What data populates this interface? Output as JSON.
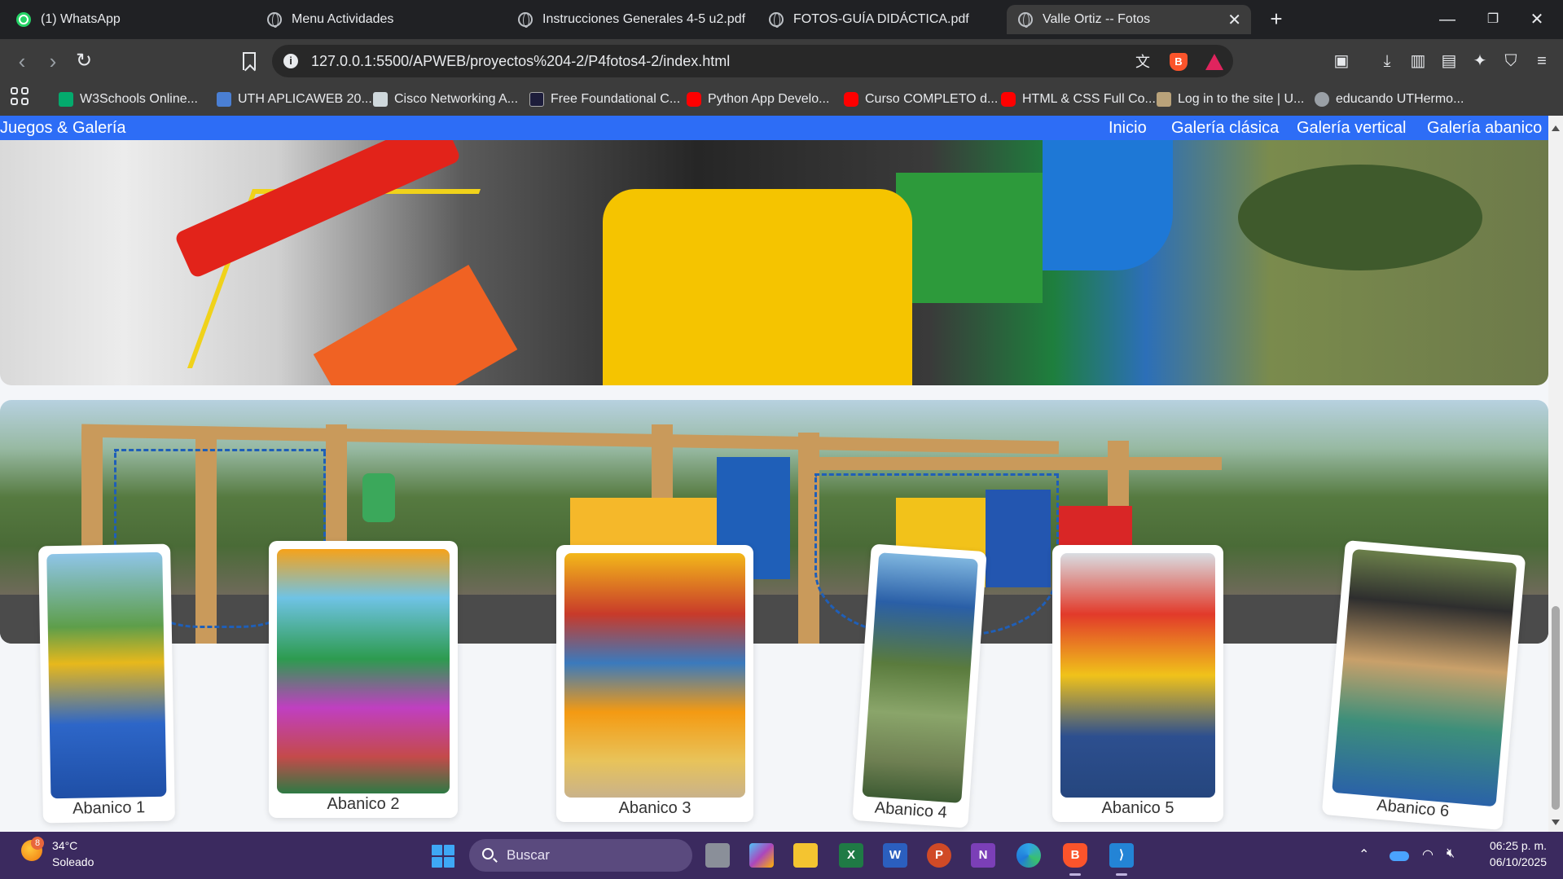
{
  "browser": {
    "tabs": [
      {
        "title": "(1) WhatsApp",
        "icon": "whatsapp-icon",
        "active": false
      },
      {
        "title": "Menu Actividades",
        "icon": "globe-icon",
        "active": false
      },
      {
        "title": "Instrucciones Generales 4-5 u2.pdf",
        "icon": "globe-icon",
        "active": false
      },
      {
        "title": "FOTOS-GUÍA DIDÁCTICA.pdf",
        "icon": "globe-icon",
        "active": false
      },
      {
        "title": "Valle Ortiz -- Fotos",
        "icon": "globe-icon",
        "active": true
      }
    ],
    "url": "127.0.0.1:5500/APWEB/proyectos%204-2/P4fotos4-2/index.html",
    "bookmarks": [
      {
        "label": "W3Schools Online...",
        "color": "#04aa6d"
      },
      {
        "label": "UTH APLICAWEB 20...",
        "color": "#4a7fd4"
      },
      {
        "label": "Cisco Networking A...",
        "color": "#cfd8dc"
      },
      {
        "label": "Free Foundational C...",
        "color": "#1d1d3b"
      },
      {
        "label": "Python App Develo...",
        "color": "#ff0000"
      },
      {
        "label": "Curso COMPLETO d...",
        "color": "#ff0000"
      },
      {
        "label": "HTML & CSS Full Co...",
        "color": "#ff0000"
      },
      {
        "label": "Log in to the site | U...",
        "color": "#b9a27a"
      },
      {
        "label": "educando UTHermo...",
        "color": "#9aa0a6"
      }
    ]
  },
  "site": {
    "brand": "Juegos & Galería",
    "nav": [
      "Inicio",
      "Galería clásica",
      "Galería vertical",
      "Galería abanico"
    ],
    "nav_color": "#2d6df6",
    "gallery": [
      {
        "caption": "Abanico 1"
      },
      {
        "caption": "Abanico 2"
      },
      {
        "caption": "Abanico 3"
      },
      {
        "caption": "Abanico 4"
      },
      {
        "caption": "Abanico 5"
      },
      {
        "caption": "Abanico 6"
      }
    ]
  },
  "taskbar": {
    "weather_badge": "8",
    "weather_temp": "34°C",
    "weather_desc": "Soleado",
    "search_placeholder": "Buscar",
    "time": "06:25 p. m.",
    "date": "06/10/2025"
  }
}
